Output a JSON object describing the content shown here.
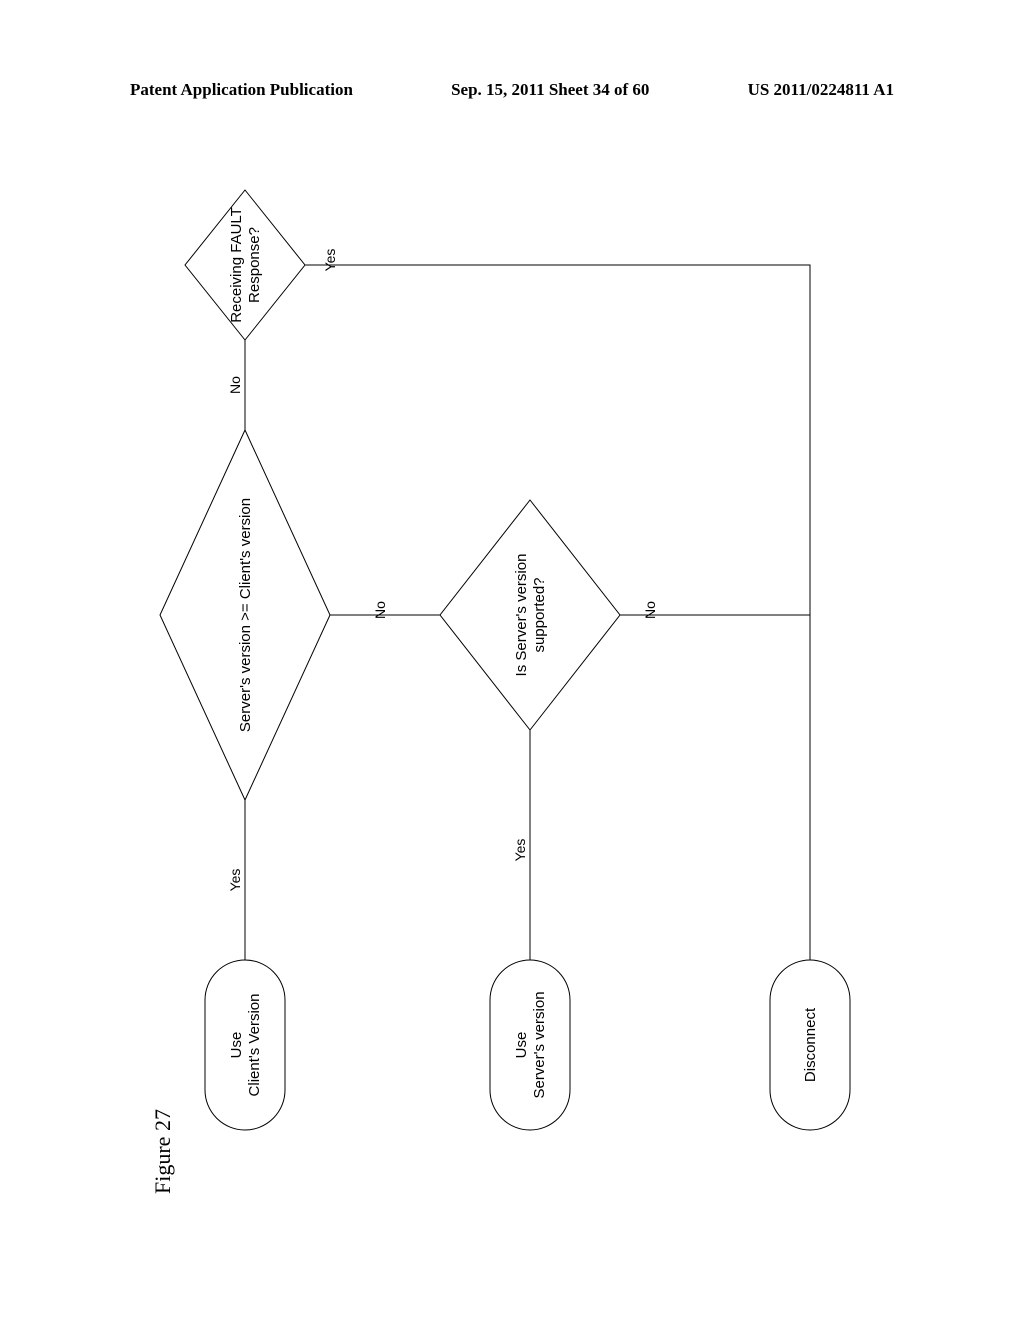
{
  "header": {
    "left": "Patent Application Publication",
    "center": "Sep. 15, 2011  Sheet 34 of 60",
    "right": "US 2011/0224811 A1"
  },
  "flow": {
    "d1": {
      "line1": "Receiving FAULT",
      "line2": "Response?"
    },
    "d2": {
      "line1": "Server's version  >=  Client's version"
    },
    "d3": {
      "line1": "Is Server's version",
      "line2": "supported?"
    },
    "t1": {
      "line1": "Use",
      "line2": "Client's Version"
    },
    "t2": {
      "line1": "Use",
      "line2": "Server's version"
    },
    "t3": {
      "line1": "Disconnect"
    },
    "edges": {
      "d1_yes": "Yes",
      "d1_no": "No",
      "d2_yes": "Yes",
      "d2_no": "No",
      "d3_yes": "Yes",
      "d3_no": "No"
    }
  },
  "figure_label": "Figure 27"
}
